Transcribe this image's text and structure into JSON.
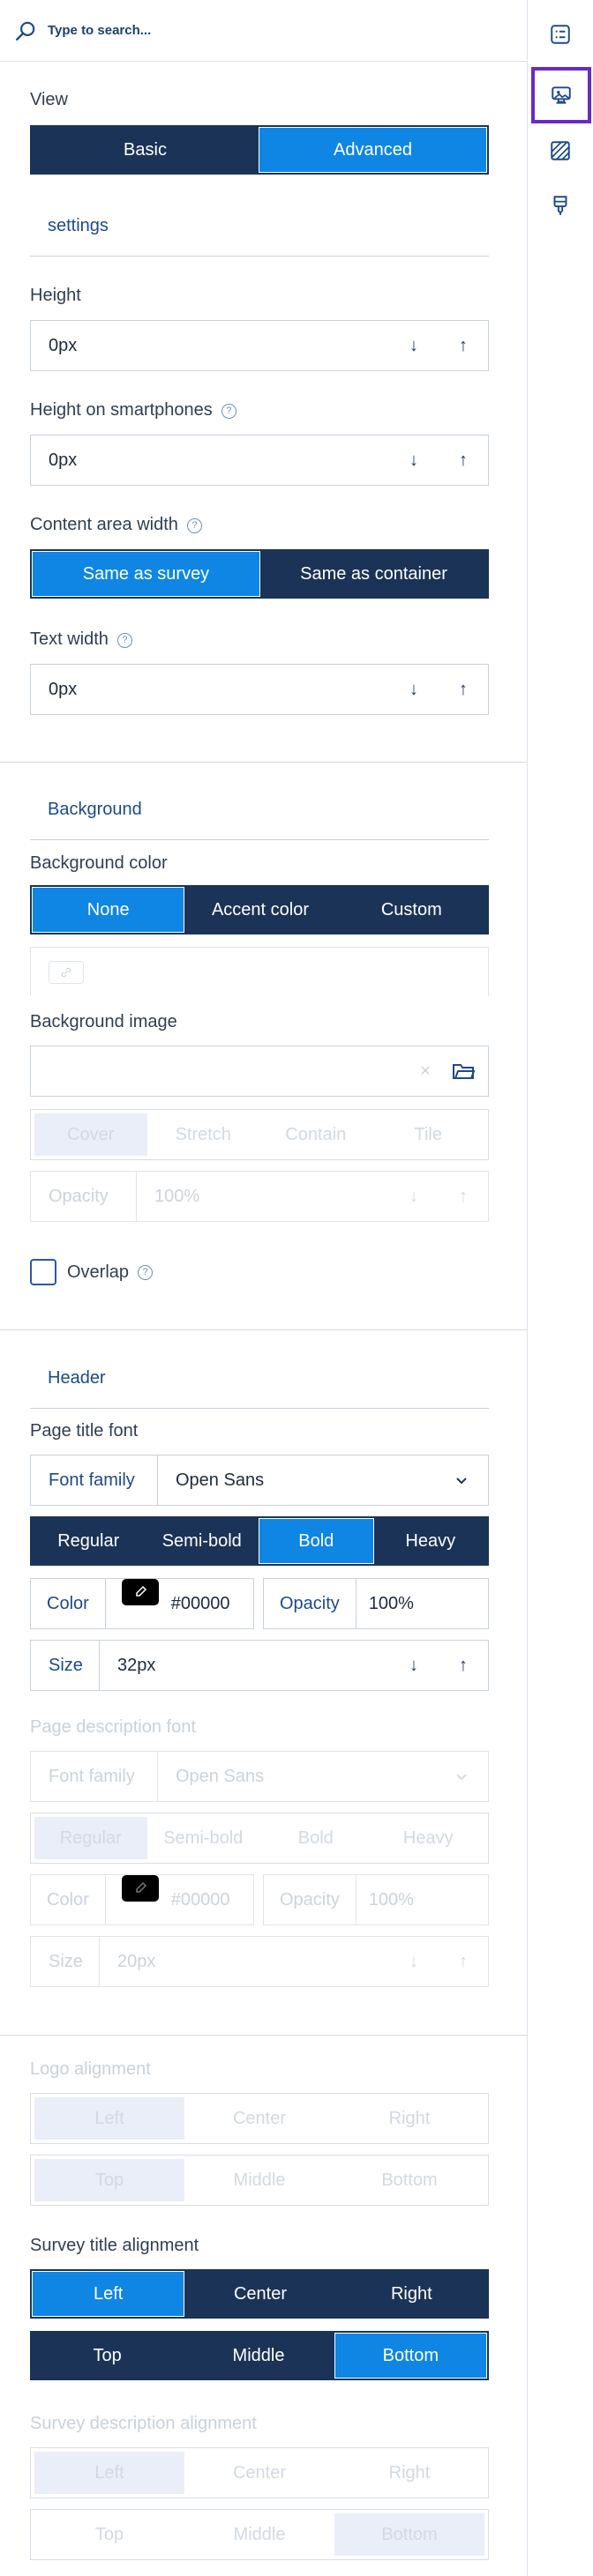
{
  "search": {
    "placeholder": "Type to search..."
  },
  "view": {
    "label": "View",
    "options": [
      "Basic",
      "Advanced"
    ],
    "selected": 1
  },
  "settings": {
    "title": "settings",
    "height": {
      "label": "Height",
      "value": "0px"
    },
    "height_mobile": {
      "label": "Height on smartphones",
      "value": "0px"
    },
    "content_width": {
      "label": "Content area width",
      "options": [
        "Same as survey",
        "Same as container"
      ],
      "selected": 0
    },
    "text_width": {
      "label": "Text width",
      "value": "0px"
    }
  },
  "background": {
    "title": "Background",
    "color_label": "Background color",
    "color_options": [
      "None",
      "Accent color",
      "Custom"
    ],
    "color_selected": 0,
    "image_label": "Background image",
    "fit_options": [
      "Cover",
      "Stretch",
      "Contain",
      "Tile"
    ],
    "opacity": {
      "label": "Opacity",
      "value": "100%"
    },
    "overlap_label": "Overlap"
  },
  "header": {
    "title": "Header",
    "title_font": {
      "label": "Page title font",
      "family_label": "Font family",
      "family_value": "Open Sans",
      "weights": [
        "Regular",
        "Semi-bold",
        "Bold",
        "Heavy"
      ],
      "weight_selected": 2,
      "color_label": "Color",
      "color_value": "#000000",
      "opacity_label": "Opacity",
      "opacity_value": "100%",
      "size_label": "Size",
      "size_value": "32px"
    },
    "desc_font": {
      "label": "Page description font",
      "family_label": "Font family",
      "family_value": "Open Sans",
      "weights": [
        "Regular",
        "Semi-bold",
        "Bold",
        "Heavy"
      ],
      "weight_selected": 0,
      "color_label": "Color",
      "color_value": "#000000",
      "opacity_label": "Opacity",
      "opacity_value": "100%",
      "size_label": "Size",
      "size_value": "20px"
    }
  },
  "alignment": {
    "logo_label": "Logo alignment",
    "survey_title_label": "Survey title alignment",
    "survey_desc_label": "Survey description alignment",
    "horizontal": [
      "Left",
      "Center",
      "Right"
    ],
    "vertical": [
      "Top",
      "Middle",
      "Bottom"
    ]
  },
  "rail": {
    "icons": [
      "list-icon",
      "theme-icon",
      "pattern-icon",
      "brush-icon"
    ],
    "active": 1
  },
  "colors": {
    "navy": "#1b3356",
    "accent": "#0f86e3",
    "active_outline": "#6a2bc2"
  }
}
